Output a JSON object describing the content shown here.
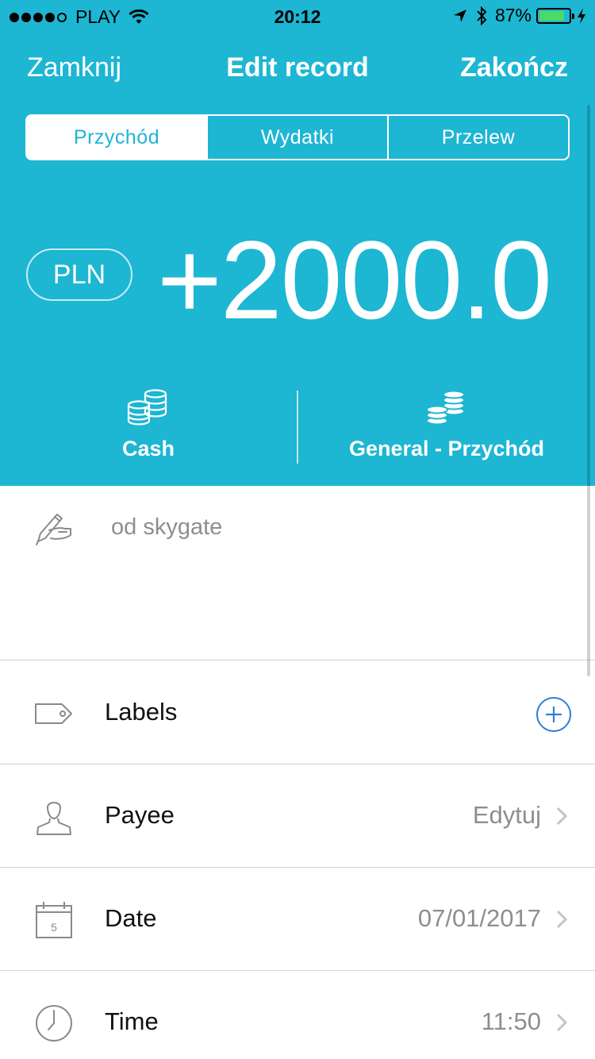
{
  "status_bar": {
    "carrier": "PLAY",
    "time": "20:12",
    "battery": "87%"
  },
  "nav": {
    "close_label": "Zamknij",
    "title": "Edit record",
    "done_label": "Zakończ"
  },
  "segments": {
    "income": "Przychód",
    "expense": "Wydatki",
    "transfer": "Przelew",
    "selected": "Przychód"
  },
  "amount": {
    "currency": "PLN",
    "value": "+2000.0"
  },
  "accounts": {
    "account": "Cash",
    "category": "General - Przychód"
  },
  "note": {
    "text": "od skygate"
  },
  "rows": {
    "labels": {
      "label": "Labels"
    },
    "payee": {
      "label": "Payee",
      "value": "Edytuj"
    },
    "date": {
      "label": "Date",
      "value": "07/01/2017",
      "icon_day": "5"
    },
    "time": {
      "label": "Time",
      "value": "11:50"
    }
  },
  "colors": {
    "accent": "#1db6d3",
    "add_button": "#2b7fd6",
    "battery": "#4cd964"
  },
  "icons": [
    "wifi-icon",
    "location-arrow-icon",
    "bluetooth-icon",
    "charging-bolt-icon",
    "coins-icon",
    "pen-hand-icon",
    "tag-icon",
    "plus-circle-icon",
    "person-icon",
    "calendar-icon",
    "clock-icon",
    "chevron-right-icon"
  ]
}
